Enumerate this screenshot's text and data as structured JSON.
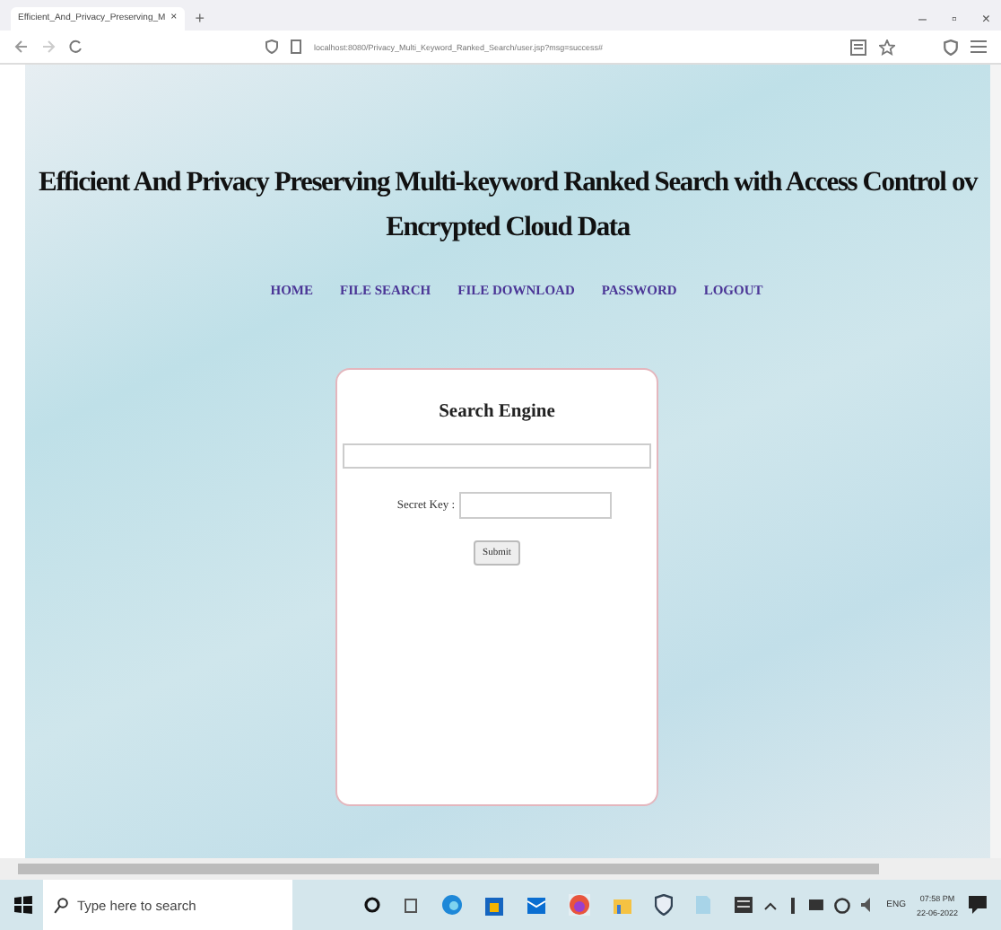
{
  "browser": {
    "tab_title": "Efficient_And_Privacy_Preserving_M",
    "tab_close": "×",
    "new_tab": "+",
    "window_controls": [
      "–",
      "▫",
      "×"
    ],
    "address": "localhost:8080/Privacy_Multi_Keyword_Ranked_Search/user.jsp?msg=success#"
  },
  "page": {
    "title_line1": "Efficient And Privacy Preserving Multi-keyword Ranked Search with Access Control ov",
    "title_line2": "Encrypted Cloud Data",
    "nav": [
      "HOME",
      "FILE SEARCH",
      "FILE DOWNLOAD",
      "PASSWORD",
      "LOGOUT"
    ],
    "form": {
      "heading": "Search Engine",
      "secret_key_label": "Secret Key :",
      "submit": "Submit"
    }
  },
  "taskbar": {
    "search_placeholder": "Type here to search",
    "language": "ENG",
    "time": "07:58 PM",
    "date": "22-06-2022"
  }
}
